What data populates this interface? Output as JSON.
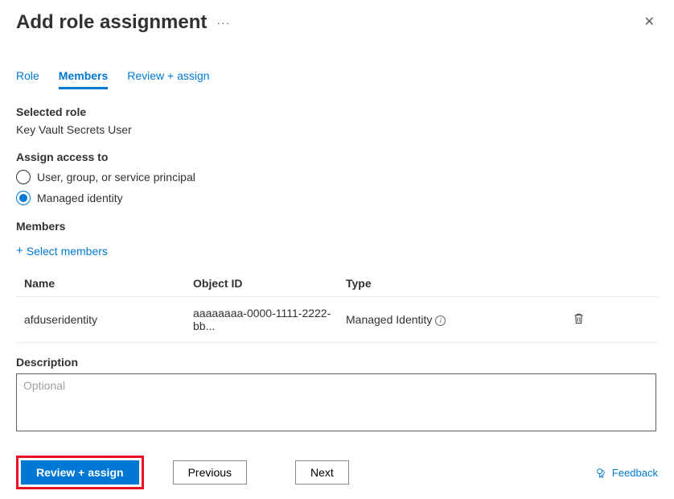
{
  "header": {
    "title": "Add role assignment"
  },
  "tabs": {
    "role": "Role",
    "members": "Members",
    "review": "Review + assign"
  },
  "selectedRole": {
    "label": "Selected role",
    "value": "Key Vault Secrets User"
  },
  "assignAccess": {
    "label": "Assign access to",
    "option1": "User, group, or service principal",
    "option2": "Managed identity"
  },
  "members": {
    "label": "Members",
    "selectLink": "Select members",
    "columns": {
      "name": "Name",
      "objectId": "Object ID",
      "type": "Type"
    },
    "rows": [
      {
        "name": "afduseridentity",
        "objectId": "aaaaaaaa-0000-1111-2222-bb...",
        "type": "Managed Identity"
      }
    ]
  },
  "description": {
    "label": "Description",
    "placeholder": "Optional"
  },
  "footer": {
    "review": "Review + assign",
    "previous": "Previous",
    "next": "Next",
    "feedback": "Feedback"
  }
}
